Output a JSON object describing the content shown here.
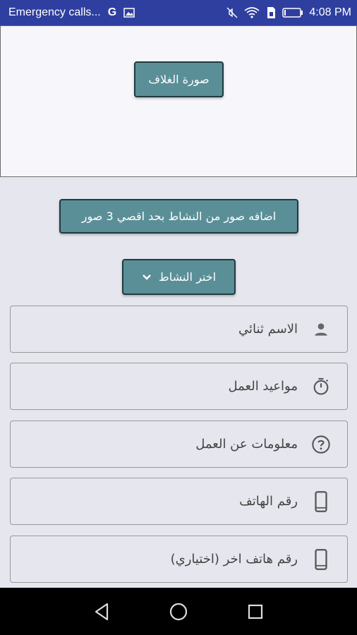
{
  "status_bar": {
    "notification_text": "Emergency calls...",
    "carrier_icon": "G",
    "time": "4:08 PM"
  },
  "cover": {
    "button_label": "صورة الغلاف"
  },
  "add_photos": {
    "button_label": "اضافه صور من النشاط بحد اقصي 3 صور"
  },
  "activity": {
    "button_label": "اختر النشاط"
  },
  "fields": [
    {
      "label": "الاسم ثنائي",
      "icon": "person-icon"
    },
    {
      "label": "مواعيد العمل",
      "icon": "timer-icon"
    },
    {
      "label": "معلومات عن العمل",
      "icon": "help-icon"
    },
    {
      "label": "رقم الهاتف",
      "icon": "phone-icon"
    },
    {
      "label": "رقم هاتف اخر (اختياري)",
      "icon": "phone-icon"
    }
  ],
  "colors": {
    "status_bar": "#2f3fa0",
    "button": "#5a8f98",
    "background": "#e6e6ee"
  }
}
